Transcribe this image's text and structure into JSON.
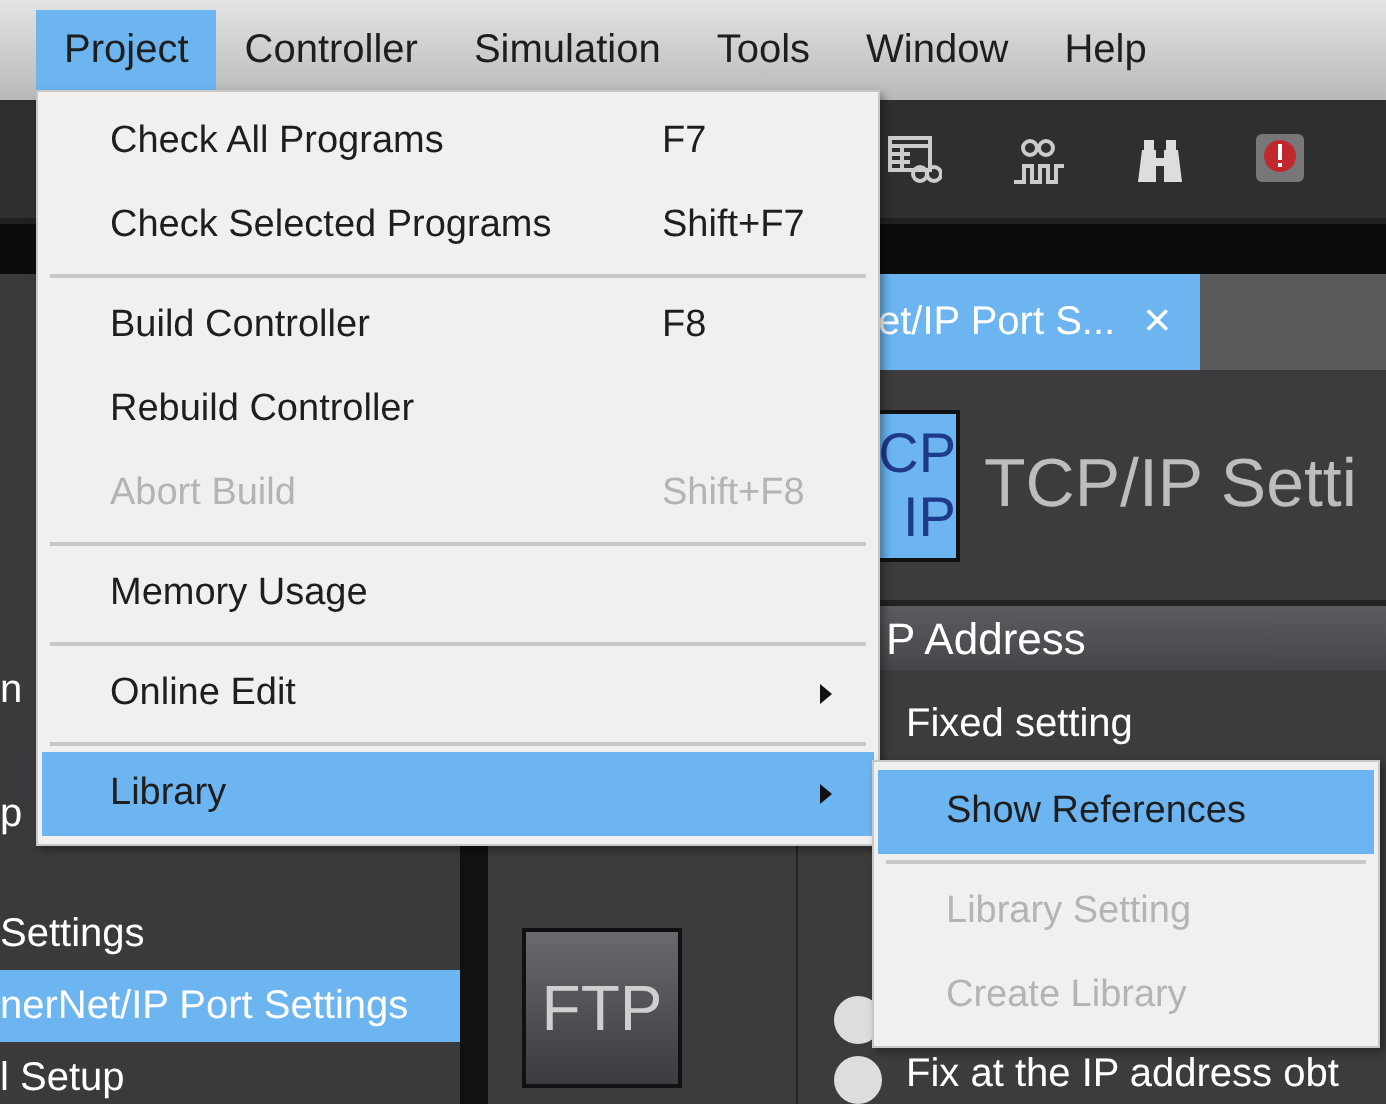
{
  "menu_bar": [
    {
      "label": "Project",
      "selected": true
    },
    {
      "label": "Controller",
      "selected": false
    },
    {
      "label": "Simulation",
      "selected": false
    },
    {
      "label": "Tools",
      "selected": false
    },
    {
      "label": "Window",
      "selected": false
    },
    {
      "label": "Help",
      "selected": false
    }
  ],
  "project_menu": {
    "items": [
      {
        "kind": "item",
        "label": "Check All Programs",
        "shortcut": "F7",
        "disabled": false,
        "selected": false
      },
      {
        "kind": "item",
        "label": "Check Selected Programs",
        "shortcut": "Shift+F7",
        "disabled": false,
        "selected": false
      },
      {
        "kind": "separator"
      },
      {
        "kind": "item",
        "label": "Build Controller",
        "shortcut": "F8",
        "disabled": false,
        "selected": false
      },
      {
        "kind": "item",
        "label": "Rebuild Controller",
        "disabled": false,
        "selected": false
      },
      {
        "kind": "item",
        "label": "Abort Build",
        "shortcut": "Shift+F8",
        "disabled": true,
        "selected": false
      },
      {
        "kind": "separator"
      },
      {
        "kind": "item",
        "label": "Memory Usage",
        "disabled": false,
        "selected": false
      },
      {
        "kind": "separator"
      },
      {
        "kind": "submenu",
        "label": "Online Edit",
        "disabled": false,
        "selected": false
      },
      {
        "kind": "separator"
      },
      {
        "kind": "submenu",
        "label": "Library",
        "disabled": false,
        "selected": true
      }
    ]
  },
  "library_submenu": {
    "items": [
      {
        "kind": "item",
        "label": "Show References",
        "disabled": false,
        "selected": true
      },
      {
        "kind": "separator"
      },
      {
        "kind": "item",
        "label": "Library Setting",
        "disabled": true,
        "selected": false
      },
      {
        "kind": "item",
        "label": "Create Library",
        "disabled": true,
        "selected": false
      }
    ]
  },
  "sidebar": {
    "items": [
      {
        "label": "n",
        "selected": false
      },
      {
        "label": "p",
        "selected": false
      },
      {
        "label": "Settings",
        "selected": false
      },
      {
        "label": "nerNet/IP Port Settings",
        "selected": true
      },
      {
        "label": "l Setup",
        "selected": false
      }
    ]
  },
  "tab": {
    "label": "et/IP Port S...",
    "close": "×",
    "selected": true
  },
  "radios": [
    {
      "selected": false
    },
    {
      "selected": false
    }
  ],
  "page": {
    "icon_lines": [
      "CP",
      "IP"
    ],
    "title": "TCP/IP Setti",
    "section": "P Address",
    "option": "Fixed setting",
    "ftp_button": "FTP",
    "radio_label": "Fix at the IP address obt"
  }
}
